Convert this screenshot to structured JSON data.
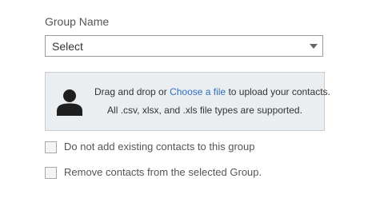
{
  "group": {
    "label": "Group Name",
    "select_value": "Select"
  },
  "upload": {
    "line1_prefix": "Drag and drop or ",
    "link_text": "Choose a file",
    "line1_suffix": " to upload your contacts.",
    "line2": "All .csv, xlsx, and .xls file types are supported.",
    "icon": "person-icon"
  },
  "options": [
    {
      "label": "Do not add existing contacts to this group",
      "checked": false
    },
    {
      "label": "Remove contacts from the selected Group.",
      "checked": false
    }
  ],
  "colors": {
    "link": "#2f6fc2",
    "dropzone_bg": "#ebeef1",
    "icon": "#1f1f1f"
  }
}
